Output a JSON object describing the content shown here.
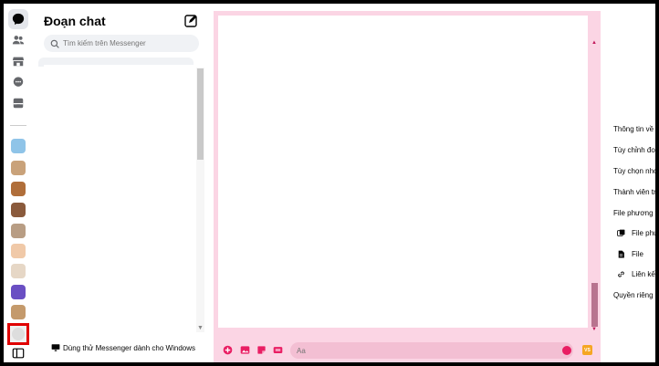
{
  "sidebar": {
    "title": "Đoạn chat",
    "search_placeholder": "Tìm kiếm trên Messenger",
    "footer_label": "Dùng thử Messenger dành cho Windows"
  },
  "composer": {
    "placeholder": "Aa",
    "badge": "VS"
  },
  "info_panel": {
    "items": [
      "Thông tin về",
      "Tùy chỉnh đoạ",
      "Tùy chọn nhó",
      "Thành viên tr",
      "File phương t",
      "File phư",
      "File",
      "Liên kết",
      "Quyền riêng"
    ]
  },
  "colors": {
    "accent": "#e91e63",
    "conversation_bg": "#fbd5e4",
    "composer_input": "#f3bfd3",
    "selection_border": "#e00000"
  },
  "avatars": [
    "#8fc4e8",
    "#c9a27a",
    "#b06e3a",
    "#8a5a3c",
    "#b89d84",
    "#f0c9a8",
    "#e6d7c6",
    "#6a4fc3",
    "#c49a6c"
  ]
}
